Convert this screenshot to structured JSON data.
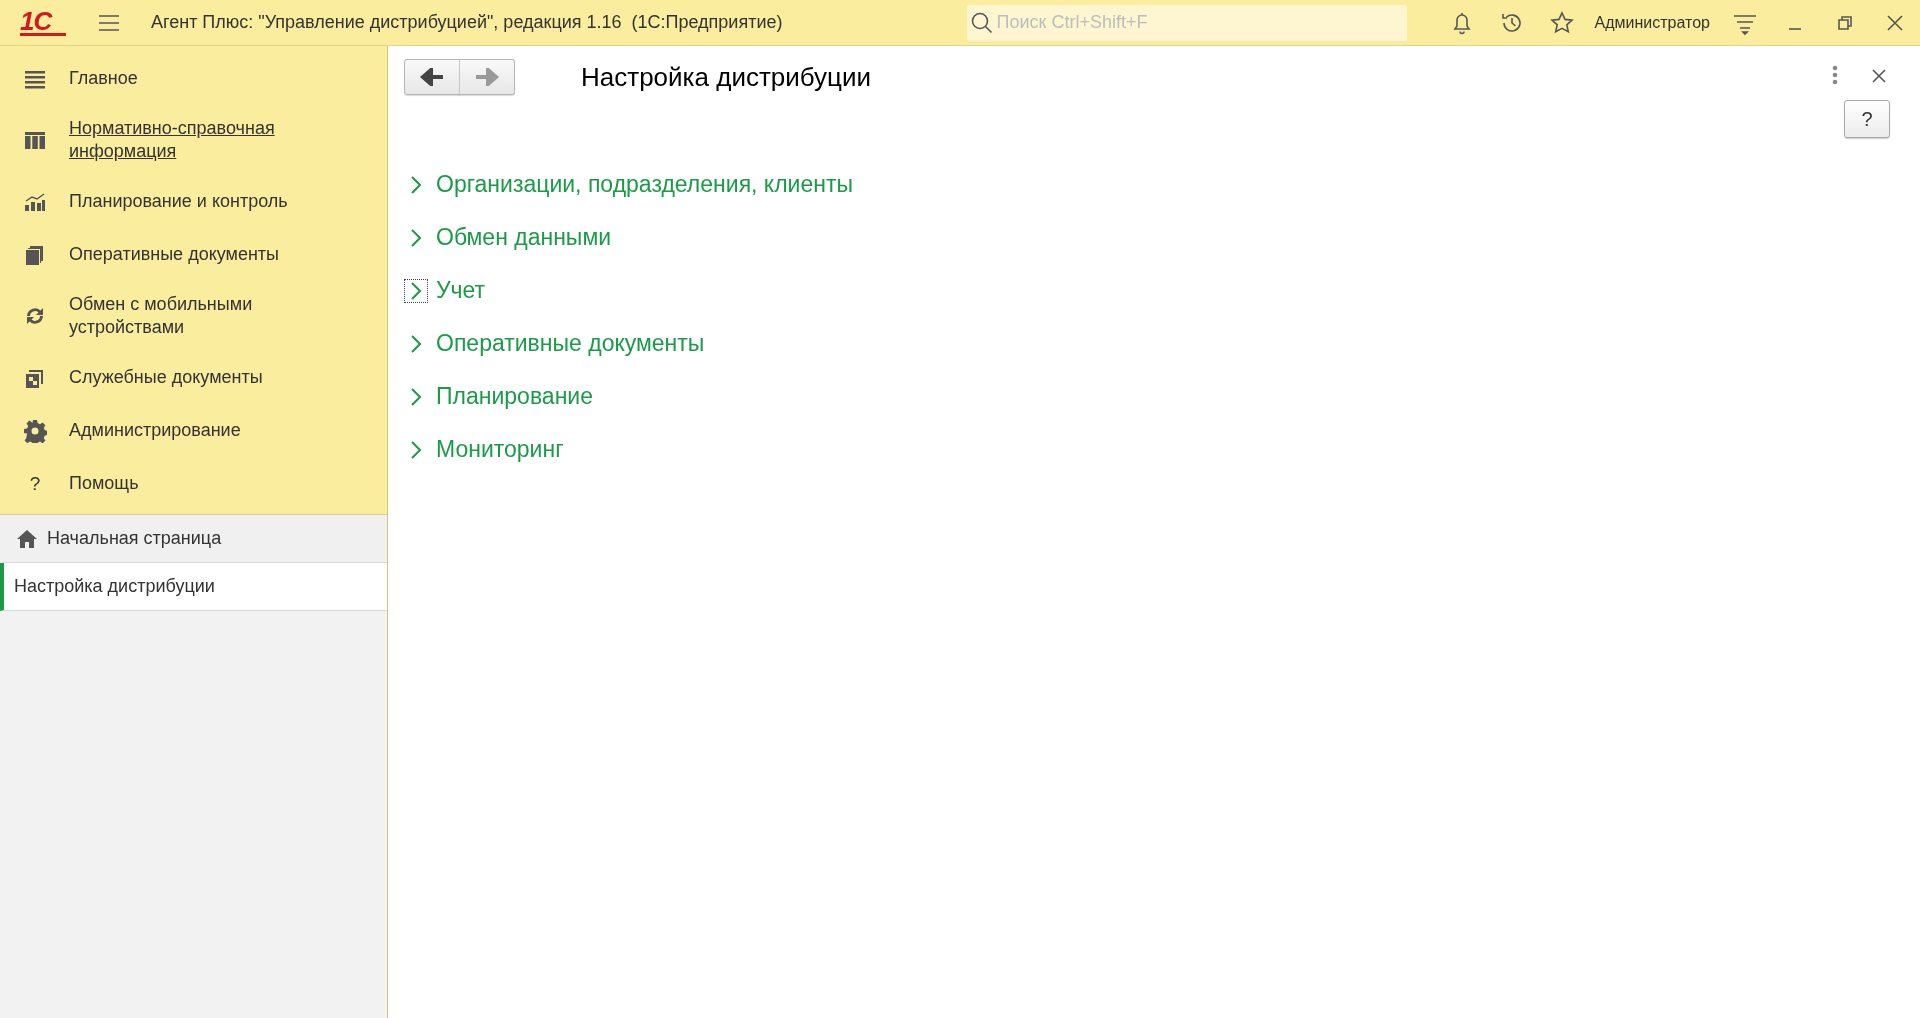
{
  "window": {
    "logo": "1С",
    "title": "Агент Плюс: \"Управление дистрибуцией\", редакция 1.16  (1С:Предприятие)"
  },
  "search": {
    "placeholder": "Поиск Ctrl+Shift+F"
  },
  "user": "Администратор",
  "sections": [
    {
      "label": "Главное",
      "hovered": false
    },
    {
      "label": "Нормативно-справочная информация",
      "hovered": true
    },
    {
      "label": "Планирование и контроль",
      "hovered": false
    },
    {
      "label": "Оперативные документы",
      "hovered": false
    },
    {
      "label": "Обмен с мобильными устройствами",
      "hovered": false
    },
    {
      "label": "Служебные документы",
      "hovered": false
    },
    {
      "label": "Администрирование",
      "hovered": false
    },
    {
      "label": "Помощь",
      "hovered": false,
      "icon_text": "?"
    }
  ],
  "open_windows": [
    {
      "label": "Начальная страница",
      "kind": "home",
      "selected": false
    },
    {
      "label": "Настройка дистрибуции",
      "kind": "form",
      "selected": true
    }
  ],
  "form": {
    "title": "Настройка дистрибуции",
    "help": "?",
    "groups": [
      {
        "label": "Организации, подразделения, клиенты",
        "expanded": false,
        "focused": false
      },
      {
        "label": "Обмен данными",
        "expanded": false,
        "focused": false
      },
      {
        "label": "Учет",
        "expanded": false,
        "focused": true
      },
      {
        "label": "Оперативные документы",
        "expanded": false,
        "focused": false
      },
      {
        "label": "Планирование",
        "expanded": false,
        "focused": false
      },
      {
        "label": "Мониторинг",
        "expanded": false,
        "focused": false
      }
    ]
  }
}
